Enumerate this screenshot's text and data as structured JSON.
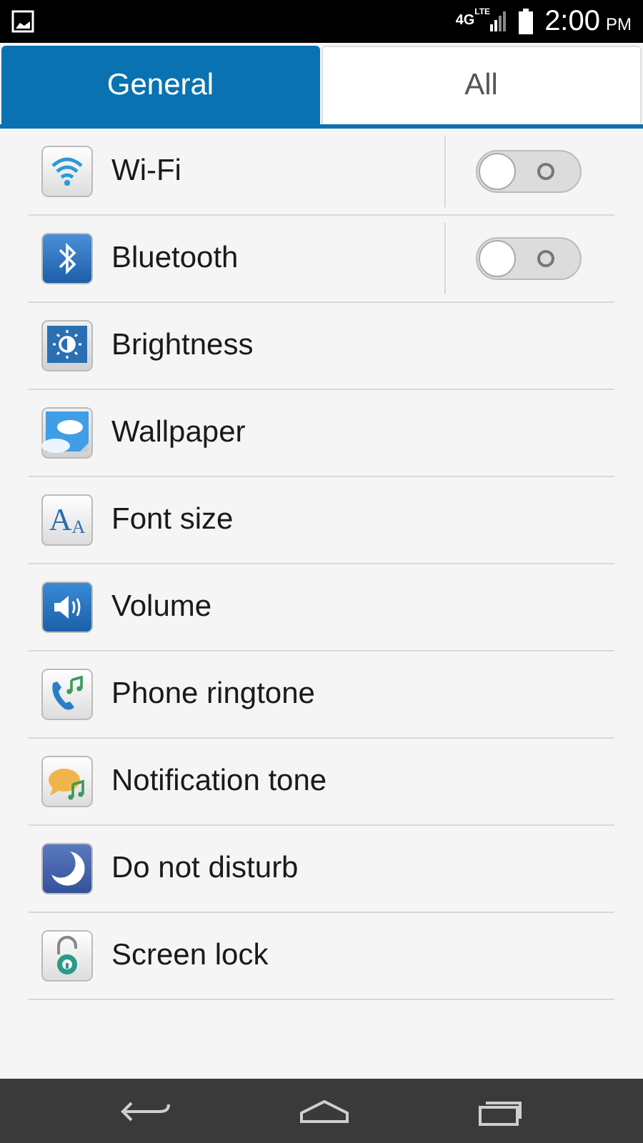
{
  "status_bar": {
    "network": "4G",
    "network_sub": "LTE",
    "time": "2:00",
    "ampm": "PM"
  },
  "tabs": [
    {
      "label": "General",
      "selected": true
    },
    {
      "label": "All",
      "selected": false
    }
  ],
  "items": [
    {
      "label": "Wi-Fi",
      "kind": "toggle",
      "on": false
    },
    {
      "label": "Bluetooth",
      "kind": "toggle",
      "on": false
    },
    {
      "label": "Brightness",
      "kind": "link"
    },
    {
      "label": "Wallpaper",
      "kind": "link"
    },
    {
      "label": "Font size",
      "kind": "link",
      "icon_letters": [
        "A",
        "A"
      ]
    },
    {
      "label": "Volume",
      "kind": "link"
    },
    {
      "label": "Phone ringtone",
      "kind": "link"
    },
    {
      "label": "Notification tone",
      "kind": "link"
    },
    {
      "label": "Do not disturb",
      "kind": "link"
    },
    {
      "label": "Screen lock",
      "kind": "link"
    }
  ]
}
